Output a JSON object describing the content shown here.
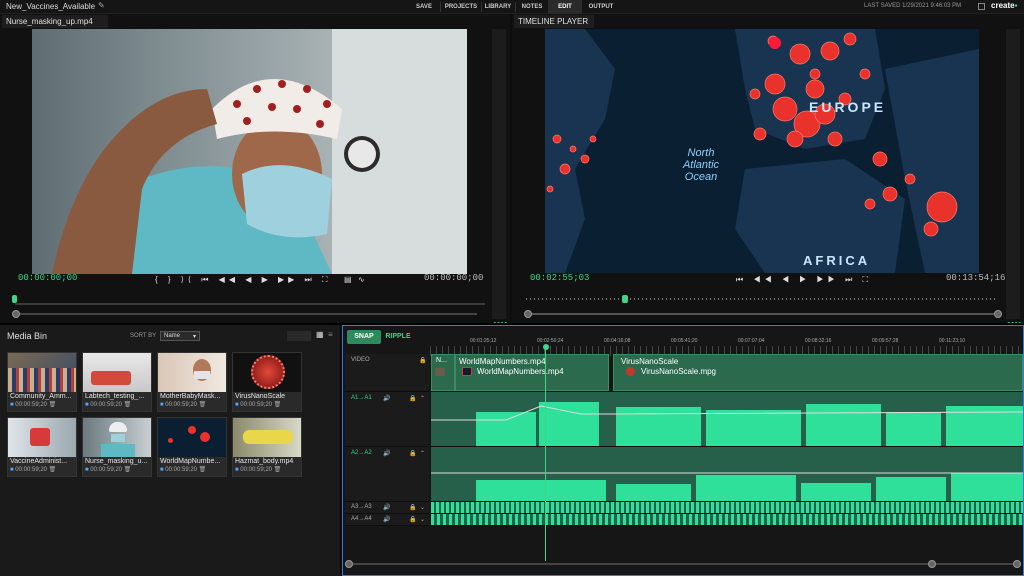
{
  "topbar": {
    "project_title": "New_Vaccines_Available",
    "nav": [
      "SAVE",
      "PROJECTS",
      "LIBRARY",
      "NOTES",
      "EDIT",
      "OUTPUT"
    ],
    "last_saved": "LAST SAVED 1/29/2021 9:46:03 PM",
    "logo": "create"
  },
  "source": {
    "title": "Nurse_masking_up.mp4",
    "tc_in": "00:00:00;00",
    "tc_out": "00:00:00;00"
  },
  "player": {
    "title": "TIMELINE PLAYER",
    "tc_in": "00:02:55;03",
    "tc_out": "00:13:54;16",
    "map_labels": [
      "EUROPE",
      "North",
      "Atlantic",
      "Ocean",
      "AFRICA"
    ]
  },
  "bin": {
    "title": "Media Bin",
    "sort_label": "SORT BY",
    "sort_value": "Name",
    "items": [
      {
        "name": "Community_Amm...",
        "dur": "00:00:59;20"
      },
      {
        "name": "Labtech_testing_...",
        "dur": "00:00:59;20"
      },
      {
        "name": "MotherBabyMask...",
        "dur": "00:00:59;20"
      },
      {
        "name": "VirusNanoScale",
        "dur": "00:00:59;20"
      },
      {
        "name": "VaccineAdminist...",
        "dur": "00:00:59;20"
      },
      {
        "name": "Nurse_masking_u...",
        "dur": "00:00:59;20"
      },
      {
        "name": "WorldMapNumbe...",
        "dur": "00:00:59;20"
      },
      {
        "name": "Hazmat_body.mp4",
        "dur": "00:00:59;20"
      }
    ]
  },
  "timeline": {
    "snap": "SNAP",
    "ripple": "RIPPLE",
    "ruler": [
      "00:01:25;12",
      "00:02:50;24",
      "00:04:16;08",
      "00:05:41;20",
      "00:07:07;04",
      "00:08:32;16",
      "00:09:57;28",
      "00:11:23;10"
    ],
    "video_label": "VIDEO",
    "clips": {
      "c1_short": "N...",
      "c1_top": "WorldMapNumbers.mp4",
      "c1_bottom": "WorldMapNumbers.mp4",
      "c2_top": "VirusNanoScale",
      "c2_bottom": "VirusNanoScale.mpg"
    },
    "tracks": [
      "A1→A1",
      "A2→A2",
      "A3→A3",
      "A4→A4"
    ]
  },
  "colors": {
    "accent": "#3fd48a",
    "audio_wave": "#2fe09a",
    "clip": "#2b6a4c",
    "selection": "#3a7bd5"
  }
}
